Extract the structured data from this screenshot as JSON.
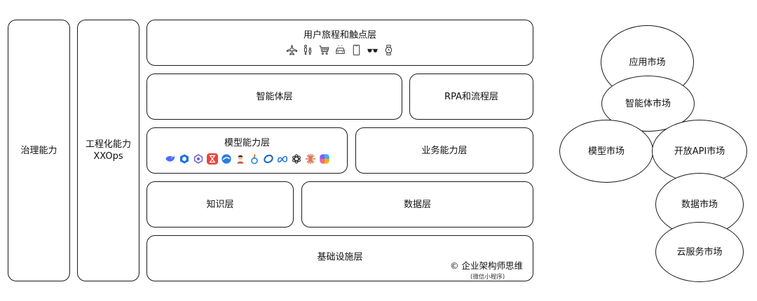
{
  "left": {
    "governance": "治理能力",
    "engineering_line1": "工程化能力",
    "engineering_line2": "XXOps"
  },
  "layers": {
    "journey": "用户旅程和触点层",
    "agent": "智能体层",
    "rpa": "RPA和流程层",
    "model": "模型能力层",
    "business": "业务能力层",
    "knowledge": "知识层",
    "data": "数据层",
    "infra": "基础设施层"
  },
  "journey_icons": [
    "airplane-icon",
    "family-icon",
    "shopping-cart-icon",
    "car-icon",
    "phone-icon",
    "sunglasses-icon",
    "watch-icon"
  ],
  "model_icons": [
    {
      "name": "deepseek-icon",
      "color": "#4d6bfe"
    },
    {
      "name": "hexagon-model-icon",
      "color": "#1a73e8"
    },
    {
      "name": "spiral-model-icon",
      "color": "#6b5bd6"
    },
    {
      "name": "hourglass-model-icon",
      "color": "#e8453c"
    },
    {
      "name": "blue-orb-icon",
      "color": "#2b7be0"
    },
    {
      "name": "avatar-model-icon",
      "color": "#c8553d"
    },
    {
      "name": "flame-model-icon",
      "color": "#1e88e5"
    },
    {
      "name": "ring-model-icon",
      "color": "#1565c0"
    },
    {
      "name": "meta-icon",
      "color": "#0668e1"
    },
    {
      "name": "openai-icon",
      "color": "#333333"
    },
    {
      "name": "claude-icon",
      "color": "#d97757"
    },
    {
      "name": "copilot-icon",
      "color": "#8a5cf6"
    }
  ],
  "markets": {
    "app": "应用市场",
    "agent": "智能体市场",
    "model": "模型市场",
    "api": "开放API市场",
    "data": "数据市场",
    "cloud": "云服务市场"
  },
  "copyright": {
    "main": "© 企业架构师思维",
    "sub": "(微信小程序)"
  }
}
